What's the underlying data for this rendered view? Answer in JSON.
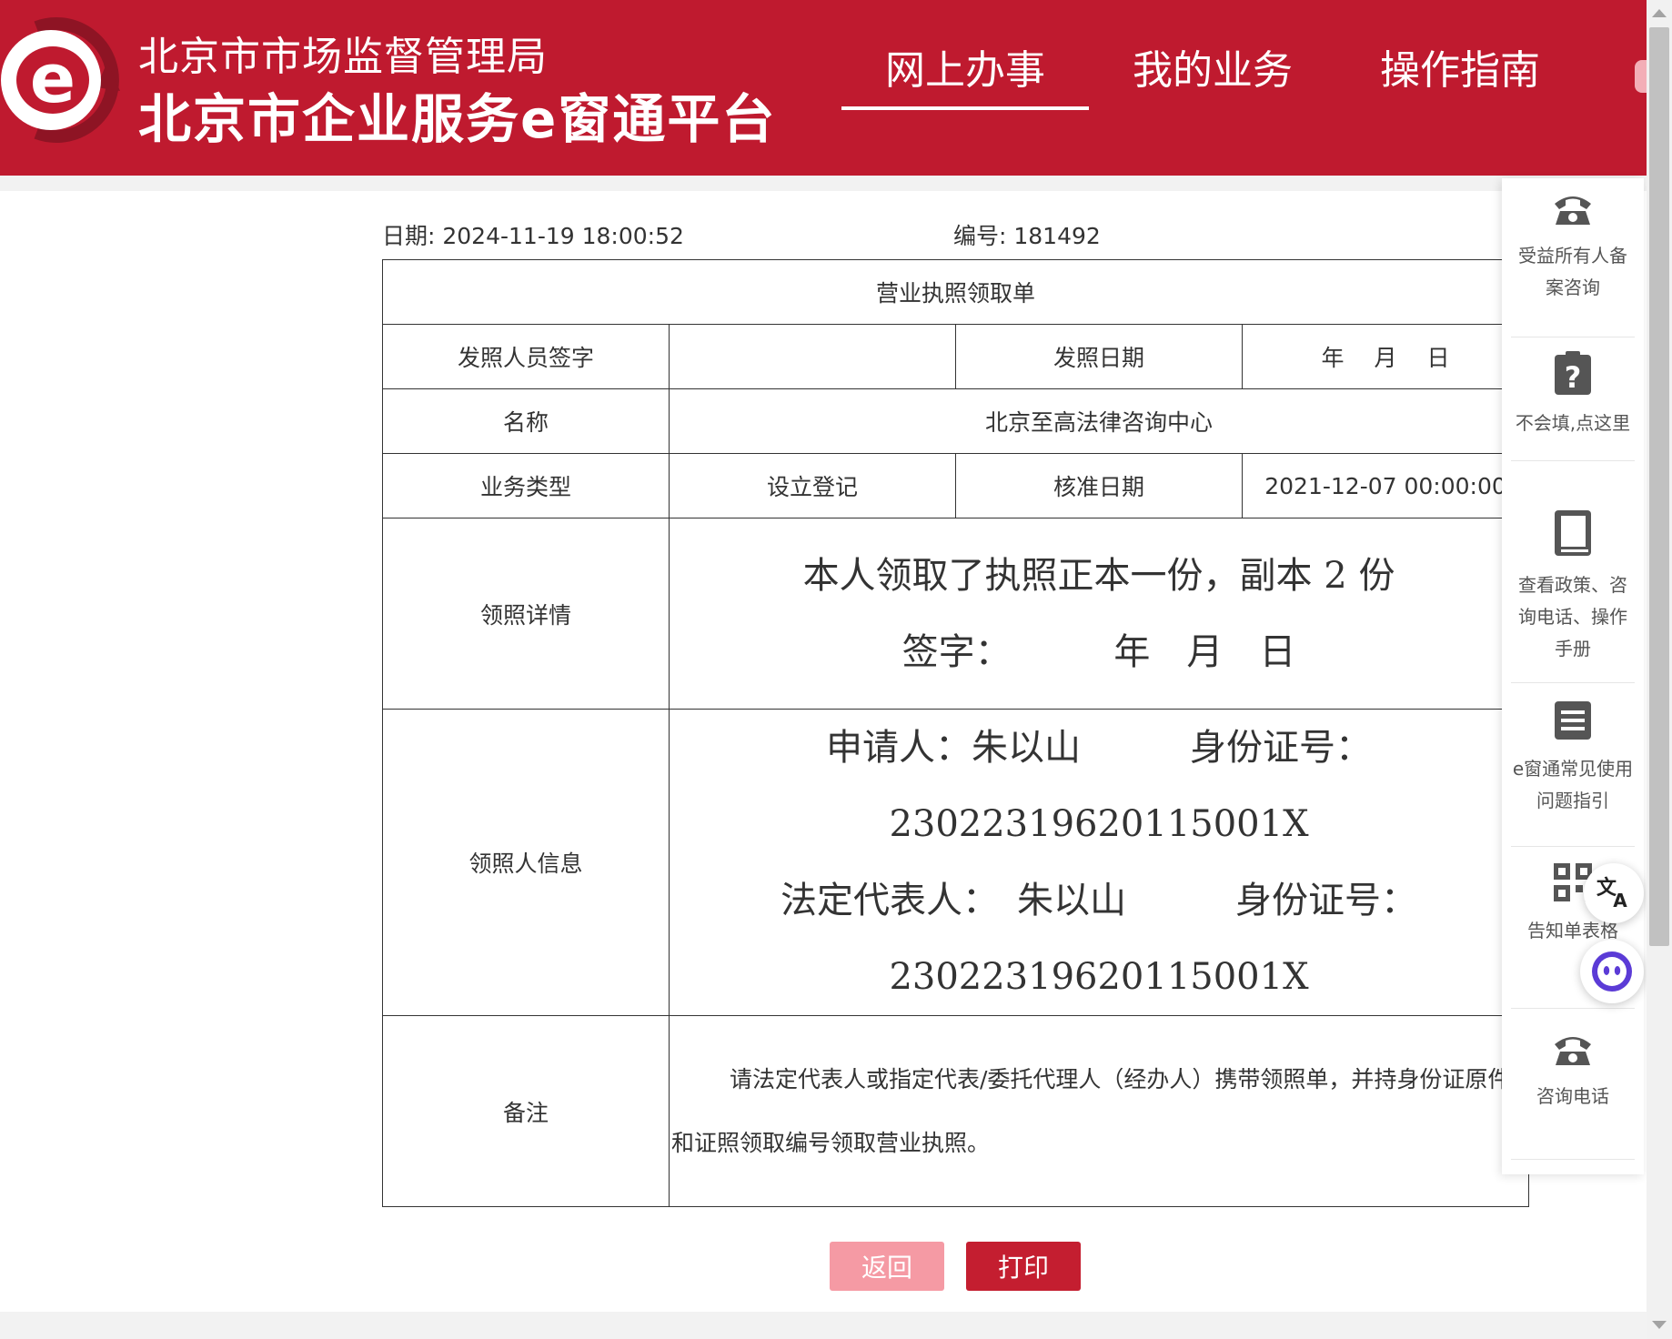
{
  "header": {
    "sub_title": "北京市市场监督管理局",
    "main_title": "北京市企业服务e窗通平台",
    "nav": [
      "网上办事",
      "我的业务",
      "操作指南"
    ],
    "brand_color": "#bf1a2f"
  },
  "doc": {
    "date": "日期: 2024-11-19 18:00:52",
    "number": "编号: 181492",
    "title": "营业执照领取单",
    "issuer_sign_label": "发照人员签字",
    "issuer_sign_value": "",
    "issue_date_label": "发照日期",
    "issue_date_value": "年　 月　 日",
    "name_label": "名称",
    "name_value": "北京至高法律咨询中心",
    "biz_type_label": "业务类型",
    "biz_type_value": "设立登记",
    "approve_date_label": "核准日期",
    "approve_date_value": "2021-12-07 00:00:00",
    "detail_label": "领照详情",
    "detail_line1": "本人领取了执照正本一份，副本 2 份",
    "detail_line2": "签字：　　　 年　月　日",
    "recipient_label": "领照人信息",
    "applicant_line": "申请人：朱以山　　　身份证号：",
    "applicant_id": "23022319620115001X",
    "legal_line": "法定代表人：　朱以山　　　身份证号：",
    "legal_id": "23022319620115001X",
    "remark_label": "备注",
    "remark_text": "请法定代表人或指定代表/委托代理人（经办人）携带领照单，并持身份证原件和证照领取编号领取营业执照。"
  },
  "buttons": {
    "back": "返回",
    "print": "打印"
  },
  "side": {
    "items": [
      {
        "icon": "phone-icon",
        "label": "受益所有人备案咨询"
      },
      {
        "icon": "question-icon",
        "label": "不会填,点这里"
      },
      {
        "icon": "book-icon",
        "label": "查看政策、咨询电话、操作手册"
      },
      {
        "icon": "document-list-icon",
        "label": "e窗通常见使用问题指引"
      },
      {
        "icon": "qr-grid-icon",
        "label": "告知单表格"
      },
      {
        "icon": "phone-icon",
        "label": "咨询电话"
      }
    ]
  }
}
